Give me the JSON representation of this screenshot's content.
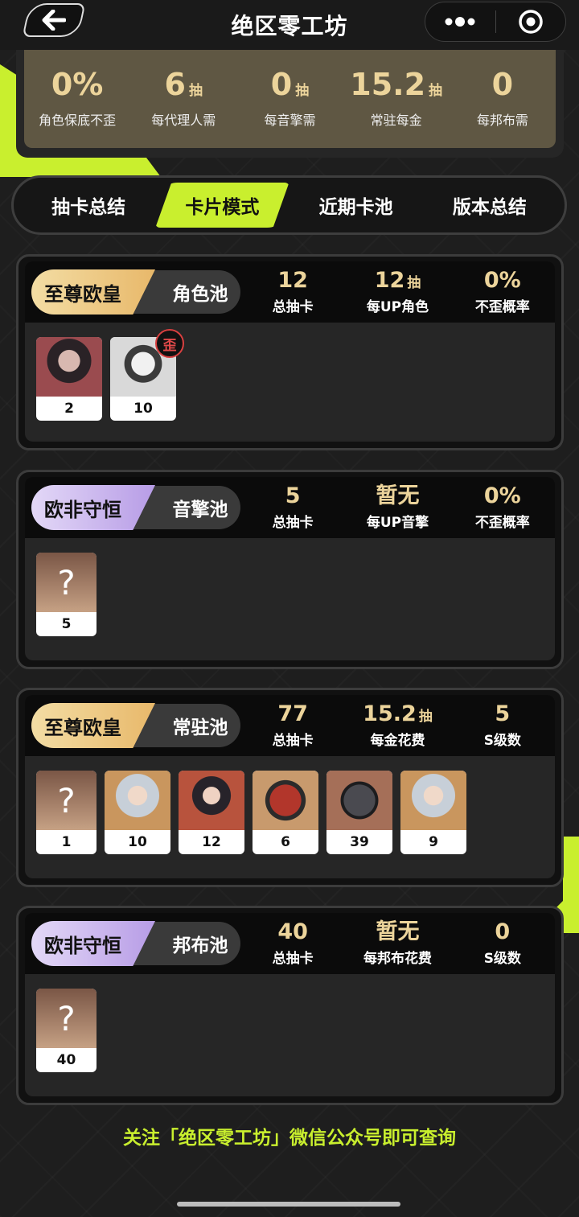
{
  "header": {
    "title": "绝区零工坊"
  },
  "summary": [
    {
      "value": "0%",
      "unit": "",
      "label": "角色保底不歪"
    },
    {
      "value": "6",
      "unit": "抽",
      "label": "每代理人需"
    },
    {
      "value": "0",
      "unit": "抽",
      "label": "每音擎需"
    },
    {
      "value": "15.2",
      "unit": "抽",
      "label": "常驻每金"
    },
    {
      "value": "0",
      "unit": "",
      "label": "每邦布需"
    }
  ],
  "tabs": [
    "抽卡总结",
    "卡片模式",
    "近期卡池",
    "版本总结"
  ],
  "active_tab": "卡片模式",
  "pools": [
    {
      "rank": "至尊欧皇",
      "rank_style": "gold",
      "pool_name": "角色池",
      "stats": [
        {
          "value": "12",
          "unit": "",
          "label": "总抽卡"
        },
        {
          "value": "12",
          "unit": "抽",
          "label": "每UP角色"
        },
        {
          "value": "0%",
          "unit": "",
          "label": "不歪概率"
        }
      ],
      "cards": [
        {
          "count": "2",
          "art": "agent-a"
        },
        {
          "count": "10",
          "art": "agent-b",
          "badge": "歪"
        }
      ]
    },
    {
      "rank": "欧非守恒",
      "rank_style": "purple",
      "pool_name": "音擎池",
      "stats": [
        {
          "value": "5",
          "unit": "",
          "label": "总抽卡"
        },
        {
          "value": "暂无",
          "unit": "",
          "label": "每UP音擎"
        },
        {
          "value": "0%",
          "unit": "",
          "label": "不歪概率"
        }
      ],
      "cards": [
        {
          "count": "5",
          "art": "q",
          "symbol": "?"
        }
      ]
    },
    {
      "rank": "至尊欧皇",
      "rank_style": "gold",
      "pool_name": "常驻池",
      "stats": [
        {
          "value": "77",
          "unit": "",
          "label": "总抽卡"
        },
        {
          "value": "15.2",
          "unit": "抽",
          "label": "每金花费"
        },
        {
          "value": "5",
          "unit": "",
          "label": "S级数"
        }
      ],
      "cards": [
        {
          "count": "1",
          "art": "q",
          "symbol": "?"
        },
        {
          "count": "10",
          "art": "agent-c"
        },
        {
          "count": "12",
          "art": "agent-d"
        },
        {
          "count": "6",
          "art": "bang-red"
        },
        {
          "count": "39",
          "art": "bang-dark"
        },
        {
          "count": "9",
          "art": "agent-c"
        }
      ]
    },
    {
      "rank": "欧非守恒",
      "rank_style": "purple",
      "pool_name": "邦布池",
      "stats": [
        {
          "value": "40",
          "unit": "",
          "label": "总抽卡"
        },
        {
          "value": "暂无",
          "unit": "",
          "label": "每邦布花费"
        },
        {
          "value": "0",
          "unit": "",
          "label": "S级数"
        }
      ],
      "cards": [
        {
          "count": "40",
          "art": "q",
          "symbol": "?"
        }
      ]
    }
  ],
  "footer": {
    "note": "关注「绝区零工坊」微信公众号即可查询"
  },
  "colors": {
    "accent": "#c9ef2e",
    "gold": "#ecd49b",
    "summary_bg": "#5f5743"
  },
  "icons": {
    "back": "arrow-left-icon",
    "more": "more-dots-icon",
    "close": "target-circle-icon"
  }
}
